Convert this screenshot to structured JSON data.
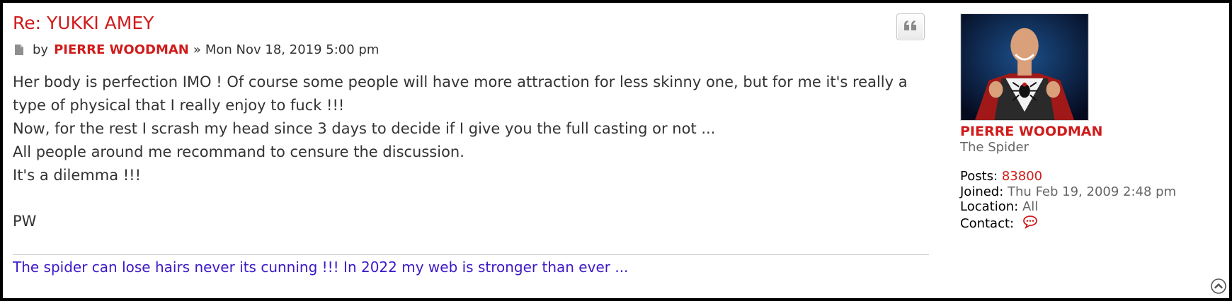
{
  "post": {
    "title": "Re: YUKKI AMEY",
    "by_label": "by",
    "author": "PIERRE WOODMAN",
    "separator": "»",
    "timestamp": "Mon Nov 18, 2019 5:00 pm",
    "body_lines": [
      "Her body is perfection IMO ! Of course some people will have more attraction for less skinny one, but for me it's really a",
      "type of physical that I really enjoy to fuck !!!",
      "Now, for the rest I scrash my head since 3 days to decide if I give you the full casting or not ...",
      "All people around me recommand to censure the discussion.",
      "It's a dilemma !!!",
      "PW"
    ],
    "signature": "The spider can lose hairs never its cunning !!! In 2022 my web is stronger than ever ..."
  },
  "profile": {
    "name": "PIERRE WOODMAN",
    "rank": "The Spider",
    "posts_label": "Posts:",
    "posts_value": "83800",
    "joined_label": "Joined:",
    "joined_value": "Thu Feb 19, 2009 2:48 pm",
    "location_label": "Location:",
    "location_value": "All",
    "contact_label": "Contact:"
  },
  "icons": {
    "post": "document-icon",
    "quote": "quote-icon",
    "contact": "speech-bubble-icon",
    "top": "chevron-up-circle-icon"
  },
  "colors": {
    "accent_red": "#d01b1b",
    "signature_blue": "#3c18c8",
    "text": "#333333",
    "muted": "#666666"
  }
}
